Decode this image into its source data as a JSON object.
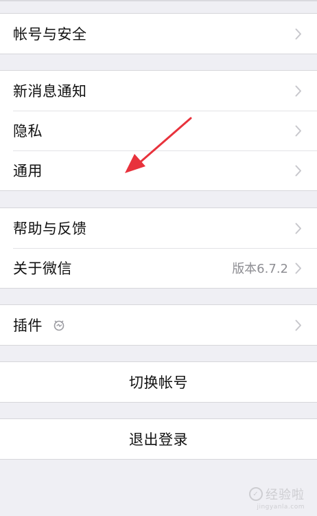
{
  "settings": {
    "group1": [
      {
        "label": "帐号与安全"
      }
    ],
    "group2": [
      {
        "label": "新消息通知"
      },
      {
        "label": "隐私"
      },
      {
        "label": "通用"
      }
    ],
    "group3": [
      {
        "label": "帮助与反馈"
      },
      {
        "label": "关于微信",
        "value": "版本6.7.2"
      }
    ],
    "group4": [
      {
        "label": "插件",
        "icon": "plugin-icon"
      }
    ],
    "switch_account": "切换帐号",
    "logout": "退出登录"
  },
  "annotation": {
    "arrow_color": "#e8323c",
    "points_to": "通用"
  },
  "watermark": {
    "brand": "经验啦",
    "url": "jingyanla.com"
  },
  "colors": {
    "background": "#efeff4",
    "cell": "#ffffff",
    "text": "#111111",
    "secondary_text": "#8e8e93",
    "chevron": "#c7c7cc"
  }
}
